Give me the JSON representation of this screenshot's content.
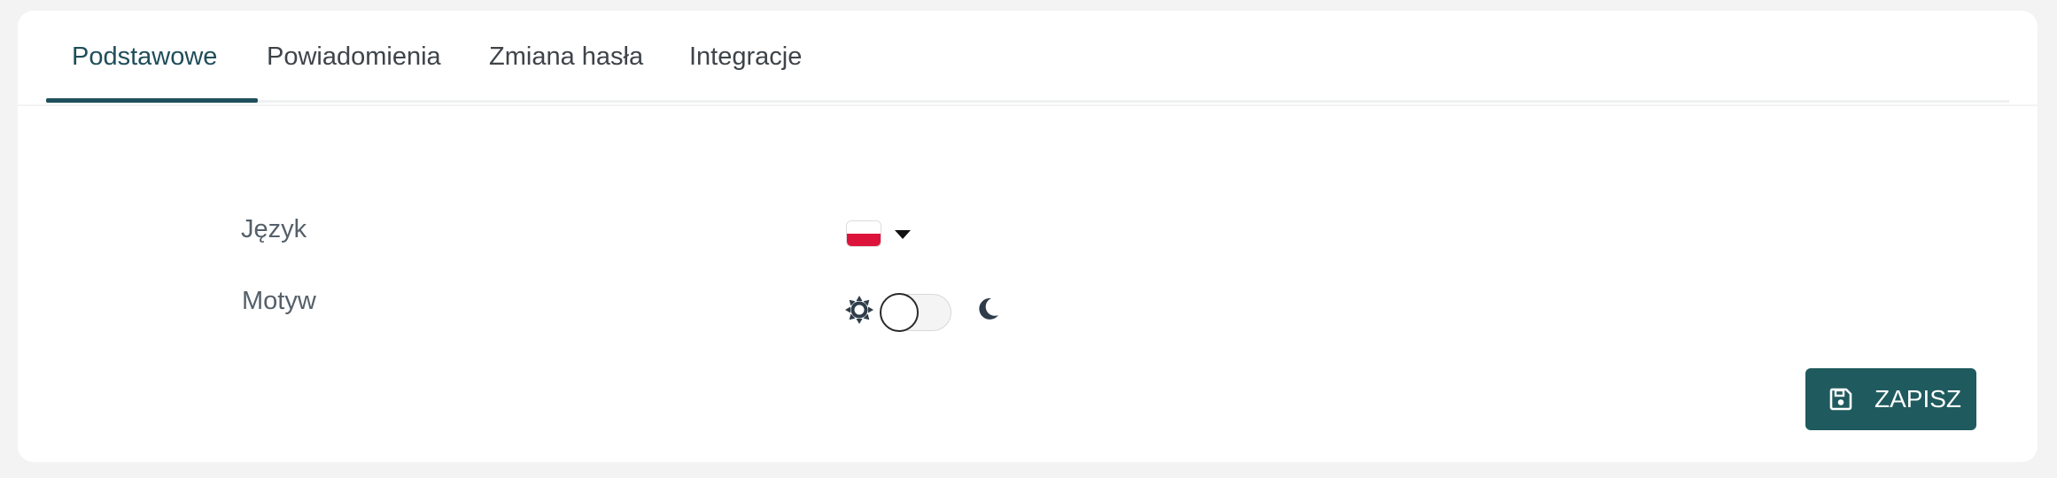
{
  "tabs": [
    {
      "label": "Podstawowe",
      "active": true
    },
    {
      "label": "Powiadomienia",
      "active": false
    },
    {
      "label": "Zmiana hasła",
      "active": false
    },
    {
      "label": "Integracje",
      "active": false
    }
  ],
  "settings": {
    "language": {
      "label": "Język",
      "selected_flag": "poland-flag-icon",
      "dropdown_icon": "caret-down-icon"
    },
    "theme": {
      "label": "Motyw",
      "light_icon": "sun-icon",
      "dark_icon": "moon-icon",
      "dark_mode_enabled": false
    }
  },
  "actions": {
    "save_label": "ZAPISZ",
    "save_icon": "floppy-disk-icon"
  },
  "colors": {
    "accent": "#1f4e5a",
    "button_bg": "#1f5a5e",
    "flag_red": "#dc143c"
  }
}
